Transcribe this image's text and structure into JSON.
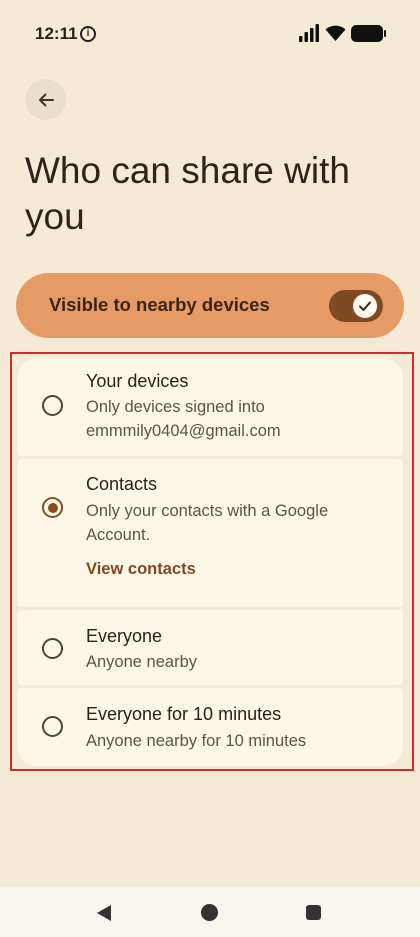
{
  "status_bar": {
    "time": "12:11",
    "info_icon": "i"
  },
  "header": {
    "back_icon": "arrow-back-icon",
    "title": "Who can share with you"
  },
  "visibility": {
    "label": "Visible to nearby devices",
    "enabled": true
  },
  "options": [
    {
      "title": "Your devices",
      "description": "Only devices signed into emmmily0404@gmail.com",
      "selected": false
    },
    {
      "title": "Contacts",
      "description": "Only your contacts with a Google Account.",
      "link": "View contacts",
      "selected": true
    },
    {
      "title": "Everyone",
      "description": "Anyone nearby",
      "selected": false
    },
    {
      "title": "Everyone for 10 minutes",
      "description": "Anyone nearby for 10 minutes",
      "selected": false
    }
  ],
  "colors": {
    "background": "#f4ead5",
    "accent": "#e69b66",
    "accent_dark": "#7f4a22",
    "card": "#fdf7e8",
    "highlight": "#d42a2a"
  }
}
